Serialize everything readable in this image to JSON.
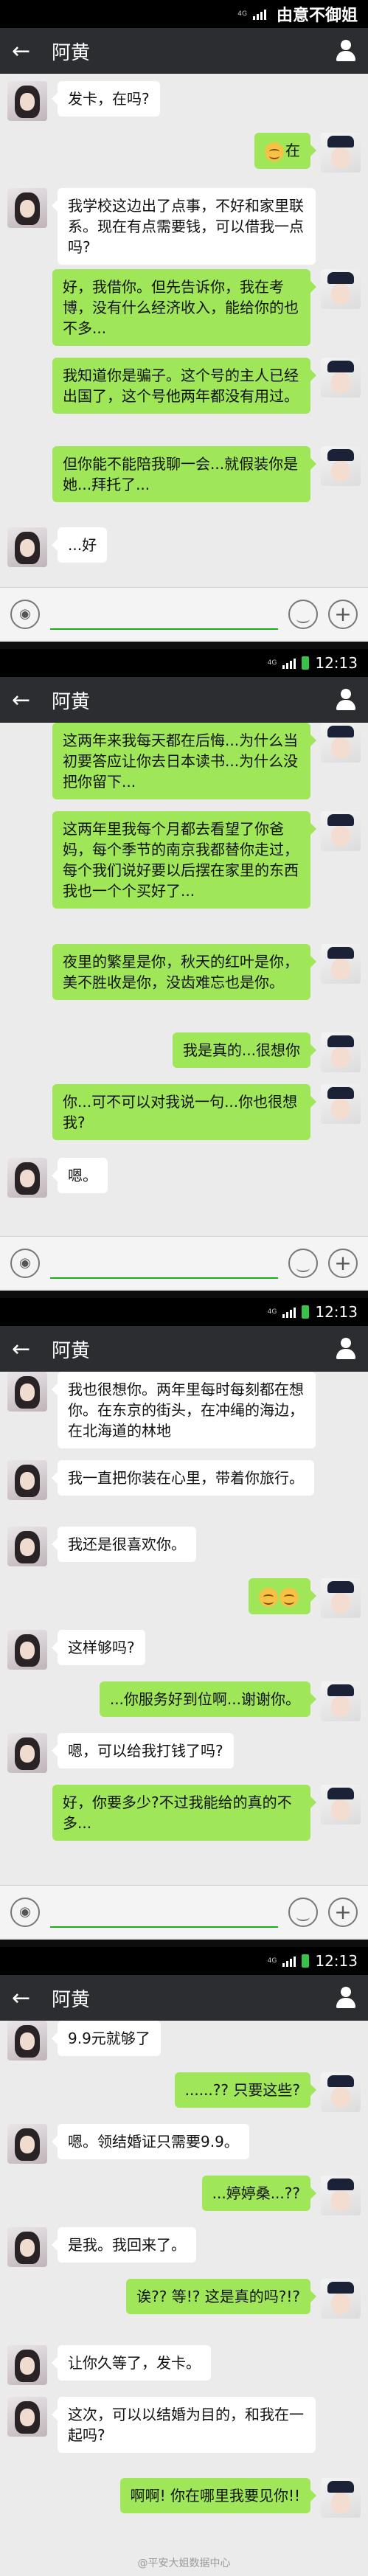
{
  "watermark_top": "由意不御姐",
  "footer_watermark": "@平安大姐数据中心",
  "chat_title": "阿黄",
  "status_time": "12:13",
  "status_net": "4G",
  "panels": [
    {
      "messages": [
        {
          "side": "left",
          "text": "发卡，在吗?"
        },
        {
          "side": "right",
          "emoji": true,
          "text": "在"
        },
        {
          "side": "left",
          "text": "我学校这边出了点事，不好和家里联系。现在有点需要钱，可以借我一点吗?"
        },
        {
          "side": "right",
          "text": "好，我借你。但先告诉你，我在考博，没有什么经济收入，能给你的也不多..."
        },
        {
          "side": "right",
          "text": "我知道你是骗子。这个号的主人已经出国了，这个号他两年都没有用过。"
        },
        {
          "side": "right",
          "text": "但你能不能陪我聊一会...就假装你是她...拜托了..."
        },
        {
          "side": "left",
          "text": "...好"
        }
      ]
    },
    {
      "messages": [
        {
          "side": "right",
          "text": "这两年来我每天都在后悔...为什么当初要答应让你去日本读书...为什么没把你留下..."
        },
        {
          "side": "right",
          "text": "这两年里我每个月都去看望了你爸妈，每个季节的南京我都替你走过，每个我们说好要以后摆在家里的东西我也一个个买好了..."
        },
        {
          "side": "right",
          "text": "夜里的繁星是你，秋天的红叶是你，美不胜收是你，没齿难忘也是你。"
        },
        {
          "side": "right",
          "text": "我是真的...很想你"
        },
        {
          "side": "right",
          "text": "你...可不可以对我说一句...你也很想我?"
        },
        {
          "side": "left",
          "text": "嗯。"
        }
      ]
    },
    {
      "messages": [
        {
          "side": "left",
          "text": "我也很想你。两年里每时每刻都在想你。在东京的街头，在冲绳的海边，在北海道的林地"
        },
        {
          "side": "left",
          "text": "我一直把你装在心里，带着你旅行。"
        },
        {
          "side": "left",
          "text": "我还是很喜欢你。"
        },
        {
          "side": "right",
          "emoji2": true,
          "text": ""
        },
        {
          "side": "left",
          "text": "这样够吗?"
        },
        {
          "side": "right",
          "text": "...你服务好到位啊...谢谢你。"
        },
        {
          "side": "left",
          "text": "嗯，可以给我打钱了吗?"
        },
        {
          "side": "right",
          "text": "好，你要多少?不过我能给的真的不多..."
        }
      ]
    },
    {
      "messages": [
        {
          "side": "left",
          "text": "9.9元就够了"
        },
        {
          "side": "right",
          "text": "......?? 只要这些?"
        },
        {
          "side": "left",
          "text": "嗯。领结婚证只需要9.9。"
        },
        {
          "side": "right",
          "text": "...婷婷桑...??"
        },
        {
          "side": "left",
          "text": "是我。我回来了。"
        },
        {
          "side": "right",
          "text": "诶?? 等!? 这是真的吗?!?"
        },
        {
          "side": "left",
          "text": "让你久等了，发卡。"
        },
        {
          "side": "left",
          "text": "这次，可以以结婚为目的，和我在一起吗?"
        },
        {
          "side": "right",
          "text": "啊啊! 你在哪里我要见你!!"
        }
      ]
    }
  ]
}
